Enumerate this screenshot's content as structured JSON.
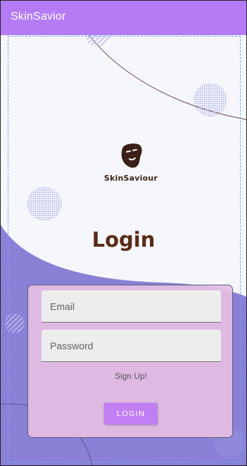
{
  "app_bar": {
    "title": "SkinSavior"
  },
  "logo": {
    "name": "SkinSaviour",
    "icon": "face-mask-icon"
  },
  "header": {
    "title": "Login"
  },
  "form": {
    "email_placeholder": "Email",
    "password_placeholder": "Password",
    "signup_label": "Sign Up!",
    "login_label": "LOGIN"
  },
  "colors": {
    "app_bar": "#b57bf5",
    "background_top": "#f6f7fc",
    "background_bottom": "#8a80d6",
    "card": "#e4bee4",
    "button": "#c17ff3",
    "title": "#5a2b1a"
  }
}
